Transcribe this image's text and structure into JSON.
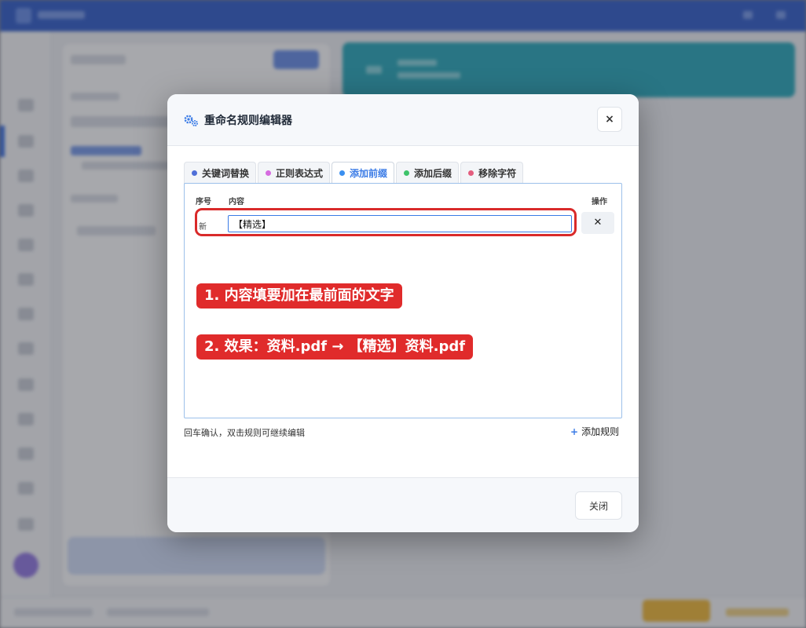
{
  "dialog": {
    "title": "重命名规则编辑器",
    "close_icon": "×",
    "tabs": [
      {
        "label": "关键词替换",
        "color": "#4f6fd8"
      },
      {
        "label": "正则表达式",
        "color": "#d66be0"
      },
      {
        "label": "添加前缀",
        "color": "#3a8ff0",
        "active": true
      },
      {
        "label": "添加后缀",
        "color": "#3ec36a"
      },
      {
        "label": "移除字符",
        "color": "#e35d7e"
      }
    ],
    "table": {
      "col_index": "序号",
      "col_content": "内容",
      "col_action": "操作",
      "row": {
        "index": "新",
        "value": "【精选】",
        "delete_icon": "✕"
      }
    },
    "annotations": [
      "1. 内容填要加在最前面的文字",
      "2. 效果：资料.pdf → 【精选】资料.pdf"
    ],
    "hint": "回车确认，双击规则可继续编辑",
    "add_rule": {
      "plus": "+",
      "label": "添加规则"
    },
    "footer": {
      "close_label": "关闭"
    }
  },
  "colors": {
    "accent": "#3a7be6",
    "annotation_red": "#e02b2b",
    "header_bg": "#f6f8fb"
  }
}
